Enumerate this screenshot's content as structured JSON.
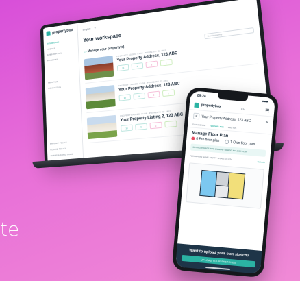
{
  "background_text": "te",
  "brand": {
    "name": "propertybox",
    "accent": "#2bb3a3",
    "dark": "#1b2b3a"
  },
  "laptop": {
    "language": "English",
    "sidebar": {
      "items": [
        {
          "label": "DASHBOARD",
          "active": true
        },
        {
          "label": "PROFILE"
        },
        {
          "label": "SUBSCRIPTION"
        },
        {
          "label": "PAYMENTS"
        },
        {
          "label": "ABOUT US"
        },
        {
          "label": "CONTACT US"
        }
      ],
      "footer": [
        "PRIVACY POLICY",
        "COOKIE POLICY",
        "TERMS & CONDITIONS"
      ]
    },
    "title": "Your workspace",
    "manage_label": "Manage your property(s)",
    "search_placeholder": "Search property",
    "properties": [
      {
        "meta": "PROPERTY ADDED: 01/04  ·  PROPERTY ID: 4862",
        "address": "Your Property Address, 123 ABC",
        "btns": [
          "10",
          "5",
          "2",
          "↓"
        ]
      },
      {
        "meta": "PROPERTY ADDED: 01/04  ·  PROPERTY ID: 4862",
        "address": "Your Property Address, 123 ABC",
        "btns": [
          "10",
          "5",
          "2",
          "↓"
        ]
      },
      {
        "meta": "PROPERTY ADDED: 01/04  ·  PROPERTY ID: 4862",
        "address": "Your Property Listing 2, 123 ABC",
        "btns": [
          "10",
          "5",
          "2",
          "↓"
        ]
      }
    ]
  },
  "phone": {
    "time": "09:24",
    "status_icons": "●●●",
    "language": "EN",
    "menu_icon": "☰",
    "address": "Your Property Address, 123 ABC",
    "back": "<",
    "tabs": [
      {
        "label": "DASHBOARD",
        "active": true
      },
      {
        "label": "FLOORPLANS"
      },
      {
        "label": "PHOTOS"
      }
    ],
    "manage_title": "Manage Floor Plan",
    "plan_option_pro": "0 Pro floor plan",
    "plan_option_own": "1 Own floor plan",
    "banner": "GET MORTGAGE TIPS ON HOW TO EDIT A FLOOR PLAN",
    "plan_meta_left": "FLOORPLAN NAME: DRAFT  ·  PLAN ID: 1234",
    "plan_meta_right": "Uploads",
    "bottom_text": "Want to upload your own sketch?",
    "bottom_button": "UPLOAD YOUR SKETCHES"
  }
}
